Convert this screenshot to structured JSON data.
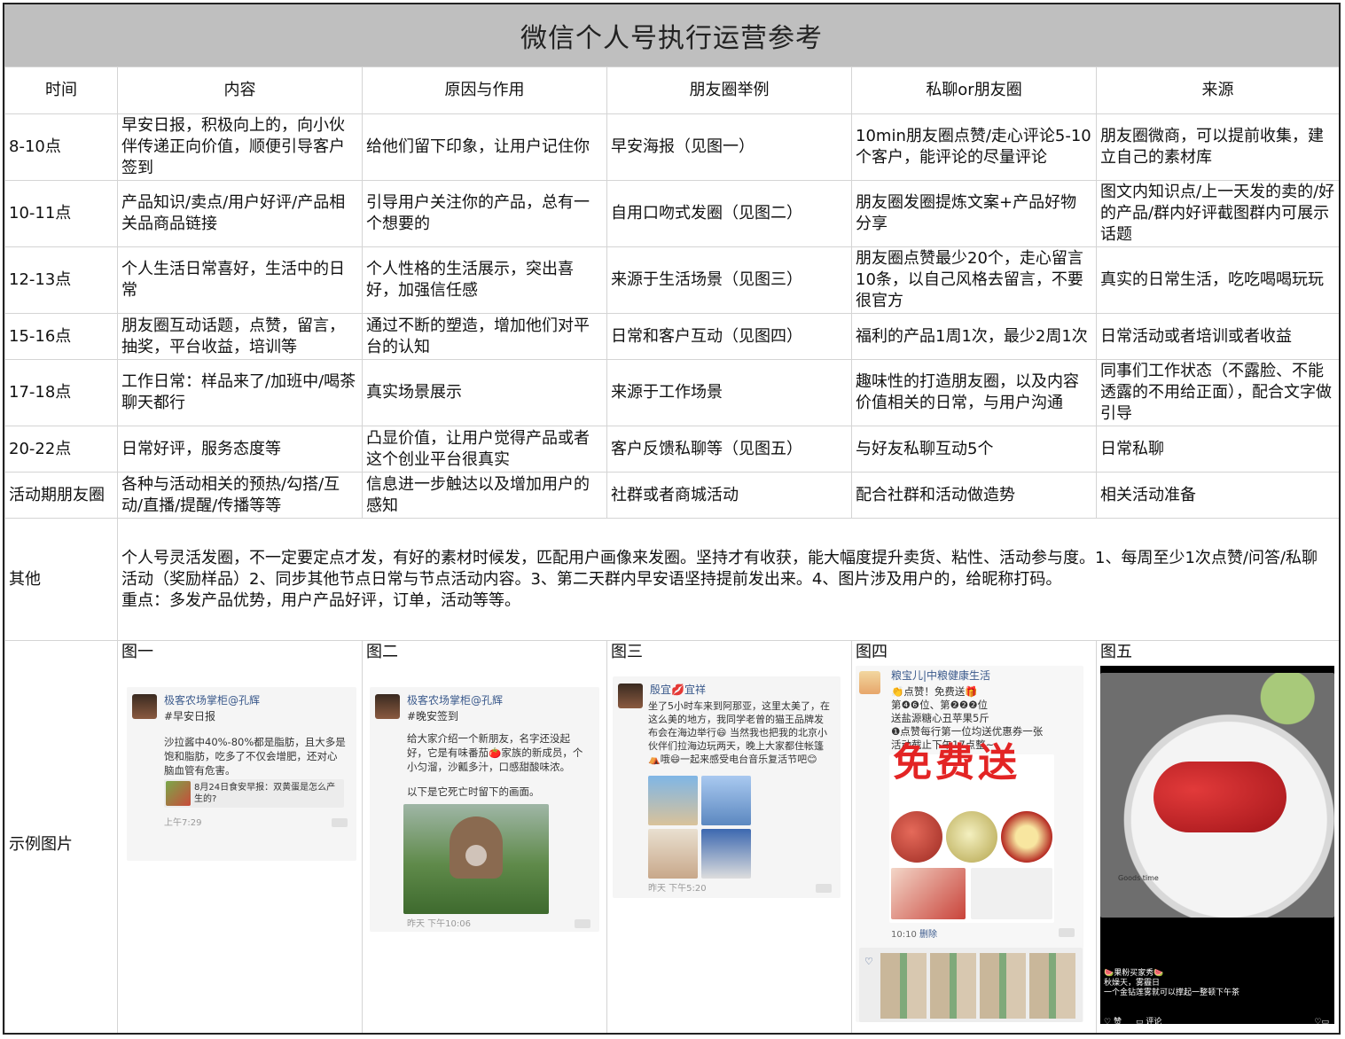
{
  "title": "微信个人号执行运营参考",
  "headers": [
    "时间",
    "内容",
    "原因与作用",
    "朋友圈举例",
    "私聊or朋友圈",
    "来源"
  ],
  "rows": [
    [
      "8-10点",
      "早安日报，积极向上的，向小伙伴传递正向价值，顺便引导客户签到",
      "给他们留下印象，让用户记住你",
      "早安海报（见图一）",
      "10min朋友圈点赞/走心评论5-10个客户，能评论的尽量评论",
      "朋友圈微商，可以提前收集，建立自己的素材库"
    ],
    [
      "10-11点",
      "产品知识/卖点/用户好评/产品相关品商品链接",
      "引导用户关注你的产品，总有一个想要的",
      "自用口吻式发圈（见图二）",
      "朋友圈发圈提炼文案+产品好物分享",
      "图文内知识点/上一天发的卖的/好的产品/群内好评截图群内可展示话题"
    ],
    [
      "12-13点",
      "个人生活日常喜好，生活中的日常",
      "个人性格的生活展示，突出喜好，加强信任感",
      "来源于生活场景（见图三）",
      "朋友圈点赞最少20个，走心留言10条，以自己风格去留言，不要很官方",
      "真实的日常生活，吃吃喝喝玩玩"
    ],
    [
      "15-16点",
      "朋友圈互动话题，点赞，留言，抽奖，平台收益，培训等",
      "通过不断的塑造，增加他们对平台的认知",
      "日常和客户互动（见图四）",
      "福利的产品1周1次，最少2周1次",
      "日常活动或者培训或者收益"
    ],
    [
      "17-18点",
      "工作日常：样品来了/加班中/喝茶聊天都行",
      "真实场景展示",
      "来源于工作场景",
      "趣味性的打造朋友圈，以及内容价值相关的日常，与用户沟通",
      "同事们工作状态（不露脸、不能透露的不用给正面），配合文字做引导"
    ],
    [
      "20-22点",
      "日常好评，服务态度等",
      "凸显价值，让用户觉得产品或者这个创业平台很真实",
      "客户反馈私聊等（见图五）",
      "与好友私聊互动5个",
      "日常私聊"
    ],
    [
      "活动期朋友圈",
      "各种与活动相关的预热/勾搭/互动/直播/提醒/传播等等",
      "信息进一步触达以及增加用户的感知",
      "社群或者商城活动",
      "配合社群和活动做造势",
      "相关活动准备"
    ]
  ],
  "other": {
    "label": "其他",
    "line1": "个人号灵活发圈，不一定要定点才发，有好的素材时候发，匹配用户画像来发圈。坚持才有收获，能大幅度提升卖货、粘性、活动参与度。1、每周至少1次点赞/问答/私聊活动（奖励样品）2、同步其他节点日常与节点活动内容。3、第二天群内早安语坚持提前发出来。4、图片涉及用户的，给昵称打码。",
    "line2": "重点：多发产品优势，用户产品好评，订单，活动等等。"
  },
  "examples": {
    "label": "示例图片",
    "figures": [
      "图一",
      "图二",
      "图三",
      "图四",
      "图五"
    ],
    "fig1": {
      "nick": "极客农场掌柜@孔辉",
      "tag": "#早安日报",
      "body": "沙拉酱中40%-80%都是脂肪，且大多是饱和脂肪，吃多了不仅会增肥，还对心脑血管有危害。",
      "link": "8月24日食安早报：双黄蛋是怎么产生的?",
      "time": "上午7:29"
    },
    "fig2": {
      "nick": "极客农场掌柜@孔辉",
      "tag": "#晚安签到",
      "body": "给大家介绍一个新朋友，名字还没起好，它是有味番茄🍅家族的新成员，个小匀溜，沙瓤多汁，口感甜酸味浓。",
      "body2": "以下是它死亡时留下的画面。",
      "time": "昨天 下午10:06"
    },
    "fig3": {
      "nick": "殷宜💋宜祥",
      "body": "坐了5小时车来到阿那亚，这里太美了，在这么美的地方，我同学老曾的猫王品牌发布会在海边举行😄 当然我也把我的北京小伙伴们拉海边玩两天，晚上大家都住帐篷⛺哦😄一起来感受电台音乐复活节吧😊",
      "time": "昨天 下午5:20"
    },
    "fig4": {
      "nick": "粮宝儿|中粮健康生活",
      "line1": "👏点赞！免费送🎁",
      "line2": "第❹❻位、第❷❷❷位",
      "line3": "送盐源糖心丑苹果5斤",
      "line4": "❶点赞每行第一位均送优惠券一张",
      "line5": "活动截止下午17点整~",
      "banner": "免费送",
      "time": "10:10",
      "delete": "删除"
    },
    "fig5": {
      "caption1": "🍉果粉买家秀🍉",
      "caption2": "秋燥天，雾霾日",
      "caption3": "一个金钻莲雾就可以撑起一整顿下午茶",
      "like": "赞",
      "comment": "评论",
      "watermark": "Goods time"
    }
  }
}
